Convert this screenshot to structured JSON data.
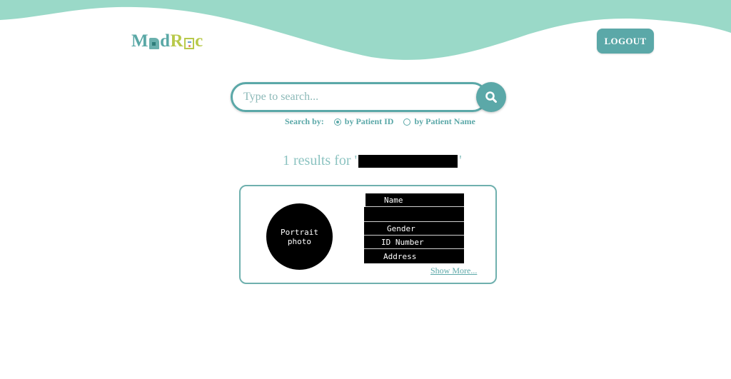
{
  "header": {
    "logo": {
      "part1": "M",
      "part2": "d",
      "part3": "R",
      "part4": "c",
      "alt": "MedRec"
    },
    "logout_label": "LOGOUT"
  },
  "search": {
    "placeholder": "Type to search...",
    "value": "",
    "search_by_label": "Search by:",
    "options": [
      {
        "label": "by Patient ID",
        "selected": true
      },
      {
        "label": "by Patient Name",
        "selected": false
      }
    ]
  },
  "results": {
    "count_text": "1 results for",
    "open_quote": "'",
    "close_quote": "'"
  },
  "card": {
    "portrait_label_line1": "Portrait",
    "portrait_label_line2": "photo",
    "fields": [
      "Name",
      "",
      "Gender",
      "ID Number",
      "Address"
    ],
    "show_more": "Show More..."
  },
  "colors": {
    "wave": "#9ad9c8",
    "accent": "#5ba8a8",
    "logo_green": "#b8c94a"
  }
}
